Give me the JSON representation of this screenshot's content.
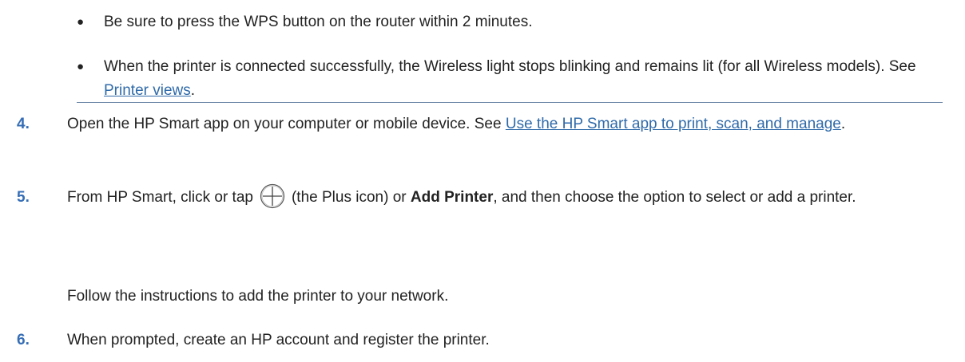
{
  "bullets": [
    {
      "marker": "●",
      "text": "Be sure to press the WPS button on the router within 2 minutes."
    },
    {
      "marker": "●",
      "text_before": "When the printer is connected successfully, the Wireless light stops blinking and remains lit (for all Wireless models). See ",
      "link": "Printer views",
      "text_after": "."
    }
  ],
  "steps": [
    {
      "number": "4.",
      "text_before": "Open the HP Smart app on your computer or mobile device. See ",
      "link": "Use the HP Smart app to print, scan, and manage",
      "text_after": "."
    },
    {
      "number": "5.",
      "text_before": "From HP Smart, click or tap",
      "icon": "plus-circle-icon",
      "text_middle": "(the Plus icon) or ",
      "bold": "Add Printer",
      "text_after": ", and then choose the option to select or add a printer.",
      "follow_up": "Follow the instructions to add the printer to your network."
    },
    {
      "number": "6.",
      "text": "When prompted, create an HP account and register the printer."
    }
  ],
  "colors": {
    "step_number": "#356db5",
    "link": "#2f6aa9",
    "rule": "#6d87a8"
  }
}
